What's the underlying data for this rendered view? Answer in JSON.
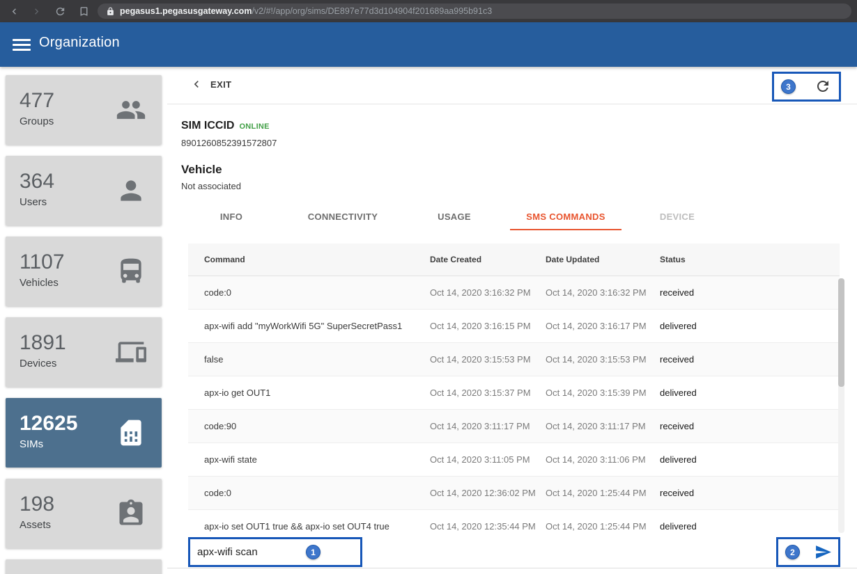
{
  "browser": {
    "url_domain": "pegasus1.pegasusgateway.com",
    "url_path": "/v2/#!/app/org/sims/DE897e77d3d104904f201689aa995b91c3"
  },
  "appbar": {
    "title": "Organization"
  },
  "sidebar": {
    "items": [
      {
        "count": "477",
        "label": "Groups",
        "icon": "groups-icon",
        "selected": false
      },
      {
        "count": "364",
        "label": "Users",
        "icon": "person-icon",
        "selected": false
      },
      {
        "count": "1107",
        "label": "Vehicles",
        "icon": "vehicle-icon",
        "selected": false
      },
      {
        "count": "1891",
        "label": "Devices",
        "icon": "devices-icon",
        "selected": false
      },
      {
        "count": "12625",
        "label": "SIMs",
        "icon": "sim-card-icon",
        "selected": true
      },
      {
        "count": "198",
        "label": "Assets",
        "icon": "assets-icon",
        "selected": false
      }
    ]
  },
  "detail": {
    "exit_label": "EXIT",
    "sim_title": "SIM ICCID",
    "sim_status": "ONLINE",
    "sim_iccid": "8901260852391572807",
    "vehicle_title": "Vehicle",
    "vehicle_value": "Not associated",
    "tabs": [
      {
        "label": "INFO",
        "state": "normal"
      },
      {
        "label": "CONNECTIVITY",
        "state": "normal"
      },
      {
        "label": "USAGE",
        "state": "normal"
      },
      {
        "label": "SMS COMMANDS",
        "state": "active"
      },
      {
        "label": "DEVICE",
        "state": "disabled"
      }
    ]
  },
  "table": {
    "headers": [
      "Command",
      "Date Created",
      "Date Updated",
      "Status"
    ],
    "rows": [
      {
        "command": "code:0",
        "created": "Oct 14, 2020 3:16:32 PM",
        "updated": "Oct 14, 2020 3:16:32 PM",
        "status": "received"
      },
      {
        "command": "apx-wifi add \"myWorkWifi 5G\" SuperSecretPass1",
        "created": "Oct 14, 2020 3:16:15 PM",
        "updated": "Oct 14, 2020 3:16:17 PM",
        "status": "delivered"
      },
      {
        "command": "false",
        "created": "Oct 14, 2020 3:15:53 PM",
        "updated": "Oct 14, 2020 3:15:53 PM",
        "status": "received"
      },
      {
        "command": "apx-io get OUT1",
        "created": "Oct 14, 2020 3:15:37 PM",
        "updated": "Oct 14, 2020 3:15:39 PM",
        "status": "delivered"
      },
      {
        "command": "code:90",
        "created": "Oct 14, 2020 3:11:17 PM",
        "updated": "Oct 14, 2020 3:11:17 PM",
        "status": "received"
      },
      {
        "command": "apx-wifi state",
        "created": "Oct 14, 2020 3:11:05 PM",
        "updated": "Oct 14, 2020 3:11:06 PM",
        "status": "delivered"
      },
      {
        "command": "code:0",
        "created": "Oct 14, 2020 12:36:02 PM",
        "updated": "Oct 14, 2020 1:25:44 PM",
        "status": "received"
      },
      {
        "command": "apx-io set OUT1 true && apx-io set OUT4 true",
        "created": "Oct 14, 2020 12:35:44 PM",
        "updated": "Oct 14, 2020 1:25:44 PM",
        "status": "delivered"
      }
    ]
  },
  "composer": {
    "input_value": "apx-wifi scan"
  },
  "annotations": {
    "input_label": "1",
    "send_label": "2",
    "refresh_label": "3"
  },
  "colors": {
    "appbar_blue": "#265d9d",
    "selected_card": "#4d708e",
    "tab_active_orange": "#e8542e",
    "online_green": "#43a047",
    "annotation_blue": "#1757b8"
  }
}
